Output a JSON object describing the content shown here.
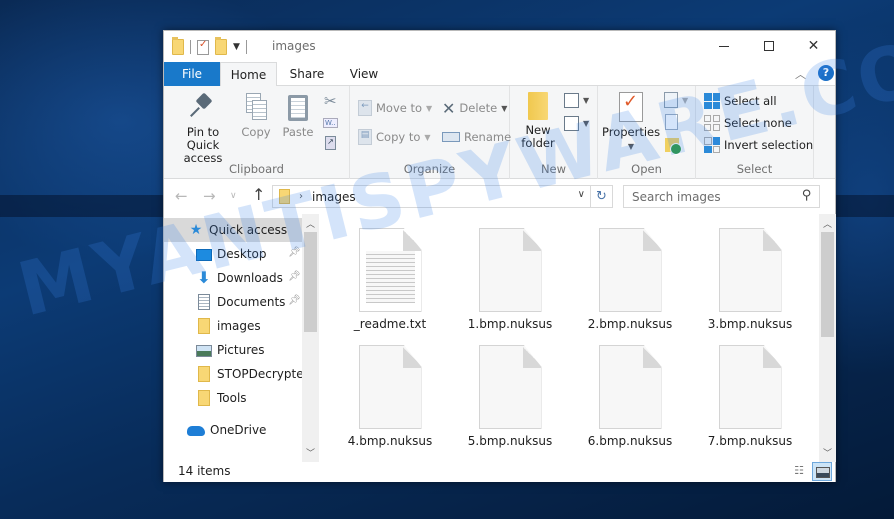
{
  "desktop": {
    "watermark": "MYANTISPYWARE.COM"
  },
  "window": {
    "title": "images",
    "controls": {
      "minimize": "minimize",
      "maximize": "maximize",
      "close": "close"
    }
  },
  "ribbon_tabs": [
    {
      "label": "File",
      "active": false
    },
    {
      "label": "Home",
      "active": true
    },
    {
      "label": "Share",
      "active": false
    },
    {
      "label": "View",
      "active": false
    }
  ],
  "ribbon": {
    "clipboard": {
      "label": "Clipboard",
      "pin": "Pin to Quick",
      "pin2": "access",
      "copy": "Copy",
      "paste": "Paste"
    },
    "organize": {
      "label": "Organize",
      "move_to": "Move to",
      "copy_to": "Copy to",
      "delete": "Delete",
      "rename": "Rename"
    },
    "new": {
      "label": "New",
      "new_folder": "New",
      "new_folder2": "folder"
    },
    "open": {
      "label": "Open",
      "properties": "Properties"
    },
    "select": {
      "label": "Select",
      "select_all": "Select all",
      "select_none": "Select none",
      "invert": "Invert selection"
    }
  },
  "address": {
    "path": "images",
    "search_placeholder": "Search images"
  },
  "nav_pane": [
    {
      "label": "Quick access",
      "icon": "star-icon",
      "selected": true,
      "pinned": false
    },
    {
      "label": "Desktop",
      "icon": "desktop-icon",
      "pinned": true
    },
    {
      "label": "Downloads",
      "icon": "download-icon",
      "pinned": true
    },
    {
      "label": "Documents",
      "icon": "documents-icon",
      "pinned": true
    },
    {
      "label": "images",
      "icon": "folder-icon",
      "pinned": false
    },
    {
      "label": "Pictures",
      "icon": "pictures-icon",
      "pinned": false
    },
    {
      "label": "STOPDecrypter",
      "icon": "folder-icon",
      "pinned": false
    },
    {
      "label": "Tools",
      "icon": "folder-icon",
      "pinned": false
    },
    {
      "label": "OneDrive",
      "icon": "onedrive-icon",
      "pinned": false
    }
  ],
  "files": [
    {
      "name": "_readme.txt",
      "type": "text"
    },
    {
      "name": "1.bmp.nuksus",
      "type": "generic"
    },
    {
      "name": "2.bmp.nuksus",
      "type": "generic"
    },
    {
      "name": "3.bmp.nuksus",
      "type": "generic"
    },
    {
      "name": "4.bmp.nuksus",
      "type": "generic"
    },
    {
      "name": "5.bmp.nuksus",
      "type": "generic"
    },
    {
      "name": "6.bmp.nuksus",
      "type": "generic"
    },
    {
      "name": "7.bmp.nuksus",
      "type": "generic"
    }
  ],
  "status": {
    "item_count": "14 items"
  },
  "colors": {
    "accent": "#1979ca",
    "folder": "#f8d775",
    "selection": "#d9d9d9"
  }
}
